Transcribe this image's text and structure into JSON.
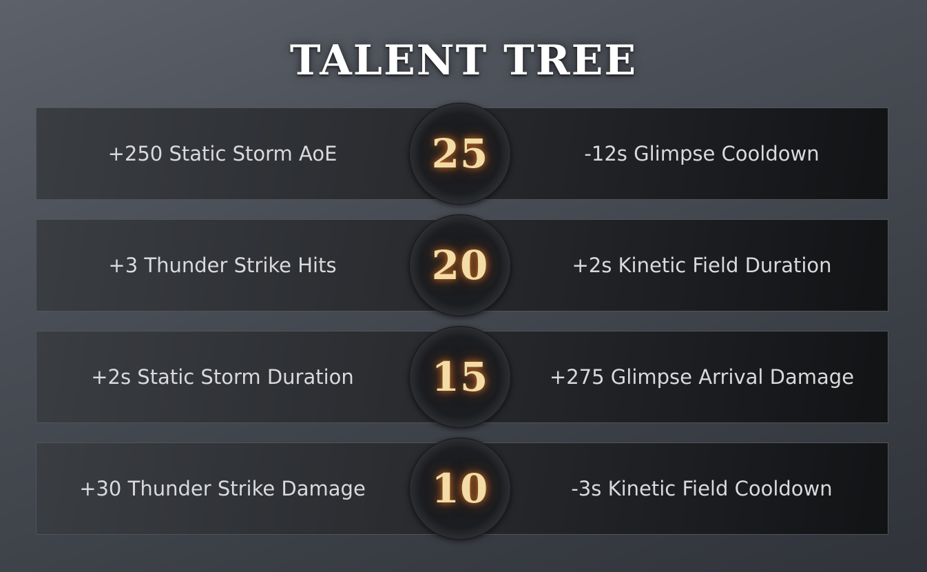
{
  "title": "TALENT TREE",
  "colors": {
    "level_text": "#f3dca6",
    "level_glow": "#de7828",
    "talent_text": "#d9dadc"
  },
  "rows": [
    {
      "level": "25",
      "left": "+250 Static Storm AoE",
      "right": "-12s Glimpse Cooldown"
    },
    {
      "level": "20",
      "left": "+3 Thunder Strike Hits",
      "right": "+2s Kinetic Field Duration"
    },
    {
      "level": "15",
      "left": "+2s Static Storm Duration",
      "right": "+275 Glimpse Arrival Damage"
    },
    {
      "level": "10",
      "left": "+30 Thunder Strike Damage",
      "right": "-3s Kinetic Field Cooldown"
    }
  ]
}
